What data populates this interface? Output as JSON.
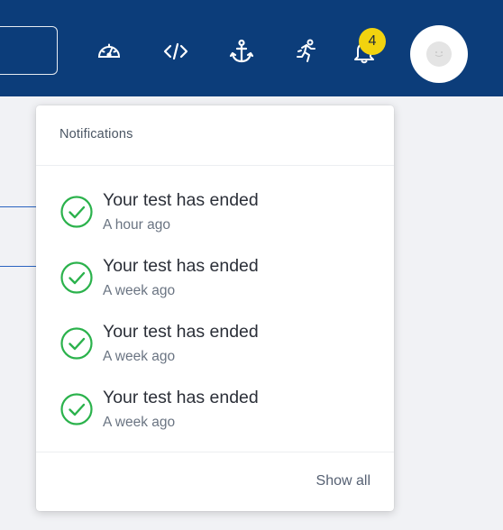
{
  "colors": {
    "topbar": "#0c3d7a",
    "badge": "#f2d30f",
    "success": "#2bb24c"
  },
  "topbar": {
    "icons": [
      "speedometer-icon",
      "code-icon",
      "anchor-icon",
      "running-person-icon",
      "bell-icon"
    ],
    "notification_count": "4"
  },
  "notifications": {
    "title": "Notifications",
    "items": [
      {
        "text": "Your test has ended",
        "time": "A hour ago",
        "icon": "check-circle-icon"
      },
      {
        "text": "Your test has ended",
        "time": "A week ago",
        "icon": "check-circle-icon"
      },
      {
        "text": "Your test has ended",
        "time": "A week ago",
        "icon": "check-circle-icon"
      },
      {
        "text": "Your test has ended",
        "time": "A week ago",
        "icon": "check-circle-icon"
      }
    ],
    "show_all": "Show all"
  }
}
